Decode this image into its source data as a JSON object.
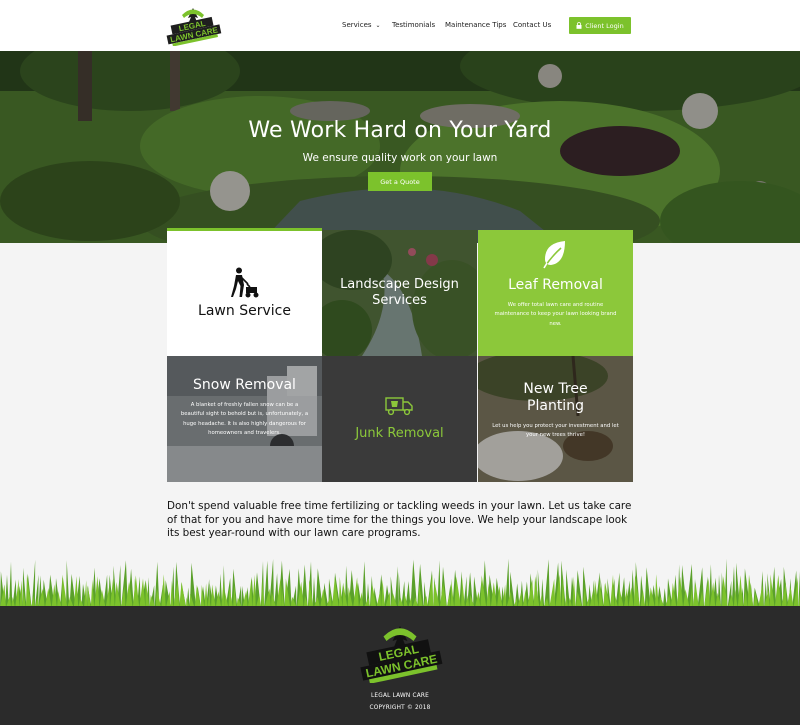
{
  "brand": {
    "logo_line1": "LEGAL",
    "logo_line2": "LAWN CARE",
    "logo_tagline": "PROFESSIONAL LAWN SERVICES",
    "accent_color": "#7cc22c"
  },
  "nav": {
    "items": [
      {
        "label": "Services",
        "has_dropdown": true
      },
      {
        "label": "Testimonials"
      },
      {
        "label": "Maintenance Tips"
      },
      {
        "label": "Contact Us"
      }
    ],
    "login_label": "Client Login",
    "login_icon": "lock-icon"
  },
  "hero": {
    "title": "We Work Hard on Your Yard",
    "subtitle": "We ensure quality work on your lawn",
    "cta_label": "Get a Quote"
  },
  "services": [
    {
      "title": "Lawn Service",
      "icon": "lawn-mower-icon"
    },
    {
      "title_line1": "Landscape Design",
      "title_line2": "Services"
    },
    {
      "title": "Leaf Removal",
      "icon": "leaf-icon",
      "body": "We offer total lawn care and routine maintenance to keep your lawn looking brand new."
    },
    {
      "title": "Snow Removal",
      "body": "A blanket of freshly fallen snow can be a beautiful sight to behold but is, unfortunately, a huge headache. It is also highly dangerous for homeowners and travelers."
    },
    {
      "title": "Junk Removal",
      "icon": "truck-icon"
    },
    {
      "title_line1": "New Tree",
      "title_line2": "Planting",
      "body": "Let us help you protect your investment and let your new trees thrive!"
    }
  ],
  "intro": "Don't spend valuable free time fertilizing or tackling weeds in your lawn. Let us take care of that for you and have more time for the things you love. We help your landscape look its best year-round with our lawn care programs.",
  "footer": {
    "company": "LEGAL LAWN CARE",
    "copyright": "COPYRIGHT © 2018"
  }
}
